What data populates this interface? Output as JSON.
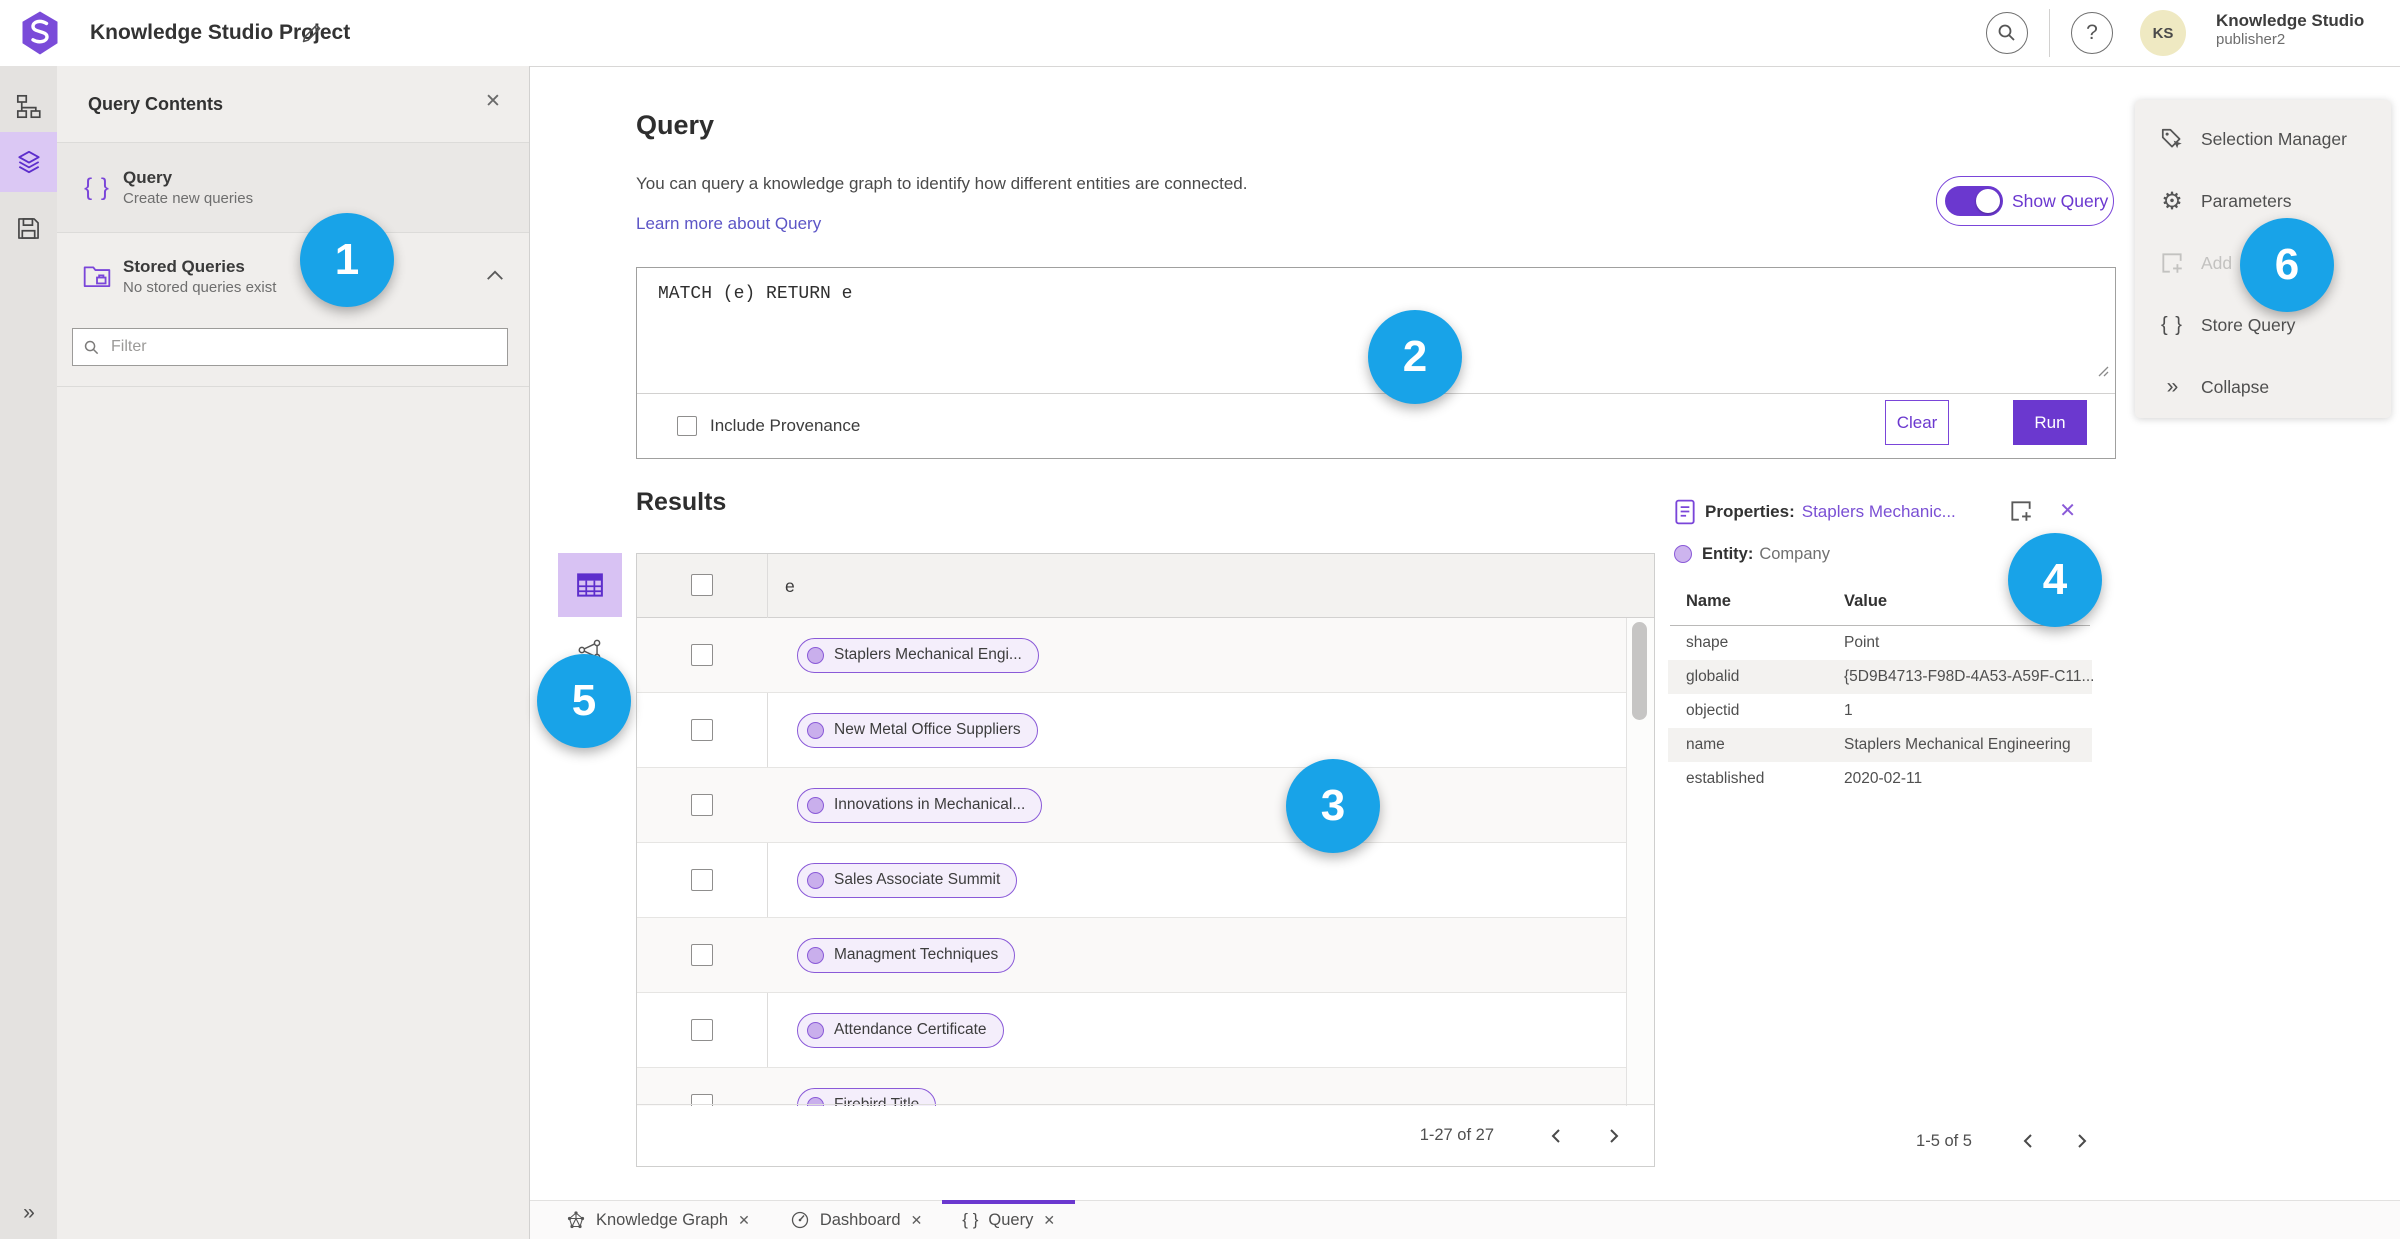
{
  "colors": {
    "accent_purple": "#6b38cf",
    "chip_border_purple": "#8a5ad8",
    "chip_fill": "#f4eefb",
    "link_purple": "#5c55c6",
    "callout_blue": "#18a3e8",
    "avatar_bg": "#efe9c2",
    "rail_selected_bg": "#dbc8f4"
  },
  "glyphs": {
    "braces": "{ }",
    "collapse": "»",
    "help": "?",
    "close": "✕",
    "gear": "⚙"
  },
  "header": {
    "title": "Knowledge Studio Project",
    "user_initials": "KS",
    "user_name": "Knowledge Studio",
    "user_role": "publisher2"
  },
  "contents_panel": {
    "title": "Query Contents",
    "query_item": {
      "label": "Query",
      "description": "Create new queries"
    },
    "stored_item": {
      "label": "Stored Queries",
      "description": "No stored queries exist"
    },
    "filter_placeholder": "Filter"
  },
  "query_section": {
    "title": "Query",
    "description": "You can query a knowledge graph to identify how different entities are connected.",
    "learn_more": "Learn more about Query",
    "show_query": "Show Query",
    "query_text": "MATCH (e) RETURN e",
    "include_provenance": "Include Provenance",
    "clear": "Clear",
    "run": "Run"
  },
  "results": {
    "title": "Results",
    "column": "e",
    "rows": [
      "Staplers Mechanical Engi...",
      "New Metal Office Suppliers",
      "Innovations in Mechanical...",
      "Sales Associate Summit",
      "Managment Techniques",
      "Attendance Certificate",
      "Firebird Title"
    ],
    "pagination": "1-27 of 27"
  },
  "properties": {
    "label": "Properties:",
    "entity_link": "Staplers Mechanic...",
    "entity_label": "Entity:",
    "entity_type": "Company",
    "col_name": "Name",
    "col_value": "Value",
    "rows": [
      {
        "name": "shape",
        "value": "Point"
      },
      {
        "name": "globalid",
        "value": "{5D9B4713-F98D-4A53-A59F-C11..."
      },
      {
        "name": "objectid",
        "value": "1"
      },
      {
        "name": "name",
        "value": "Staplers Mechanical Engineering"
      },
      {
        "name": "established",
        "value": "2020-02-11"
      }
    ],
    "pagination": "1-5 of 5"
  },
  "action_menu": {
    "items": [
      "Selection Manager",
      "Parameters",
      "Add",
      "Store Query",
      "Collapse"
    ]
  },
  "tabs": [
    {
      "label": "Knowledge Graph"
    },
    {
      "label": "Dashboard"
    },
    {
      "label": "Query"
    }
  ],
  "callouts": [
    "1",
    "2",
    "3",
    "4",
    "5",
    "6"
  ]
}
